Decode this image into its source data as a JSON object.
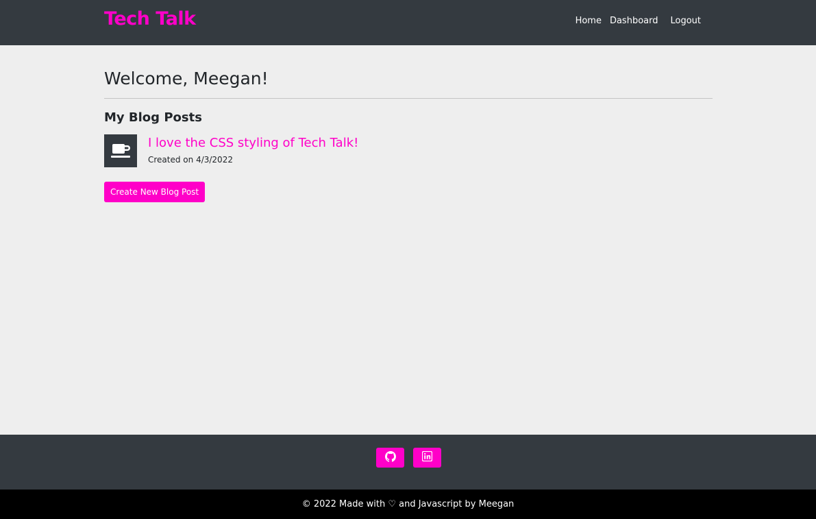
{
  "header": {
    "brand": "Tech Talk",
    "nav": {
      "home": "Home",
      "dashboard": "Dashboard",
      "logout": "Logout"
    }
  },
  "main": {
    "welcome": "Welcome, Meegan!",
    "section_title": "My Blog Posts",
    "posts": [
      {
        "icon": "coffee-cup-icon",
        "title": "I love the CSS styling of Tech Talk!",
        "date": "Created on 4/3/2022"
      }
    ],
    "create_button": "Create New Blog Post"
  },
  "footer": {
    "social": [
      {
        "icon": "github-icon"
      },
      {
        "icon": "linkedin-icon"
      }
    ],
    "copyright": "© 2022 Made with ♡ and Javascript by Meegan"
  },
  "colors": {
    "accent": "#ff00c8",
    "header_bg": "#343a40",
    "page_bg": "#eeeeee",
    "copyright_bg": "#000000"
  }
}
